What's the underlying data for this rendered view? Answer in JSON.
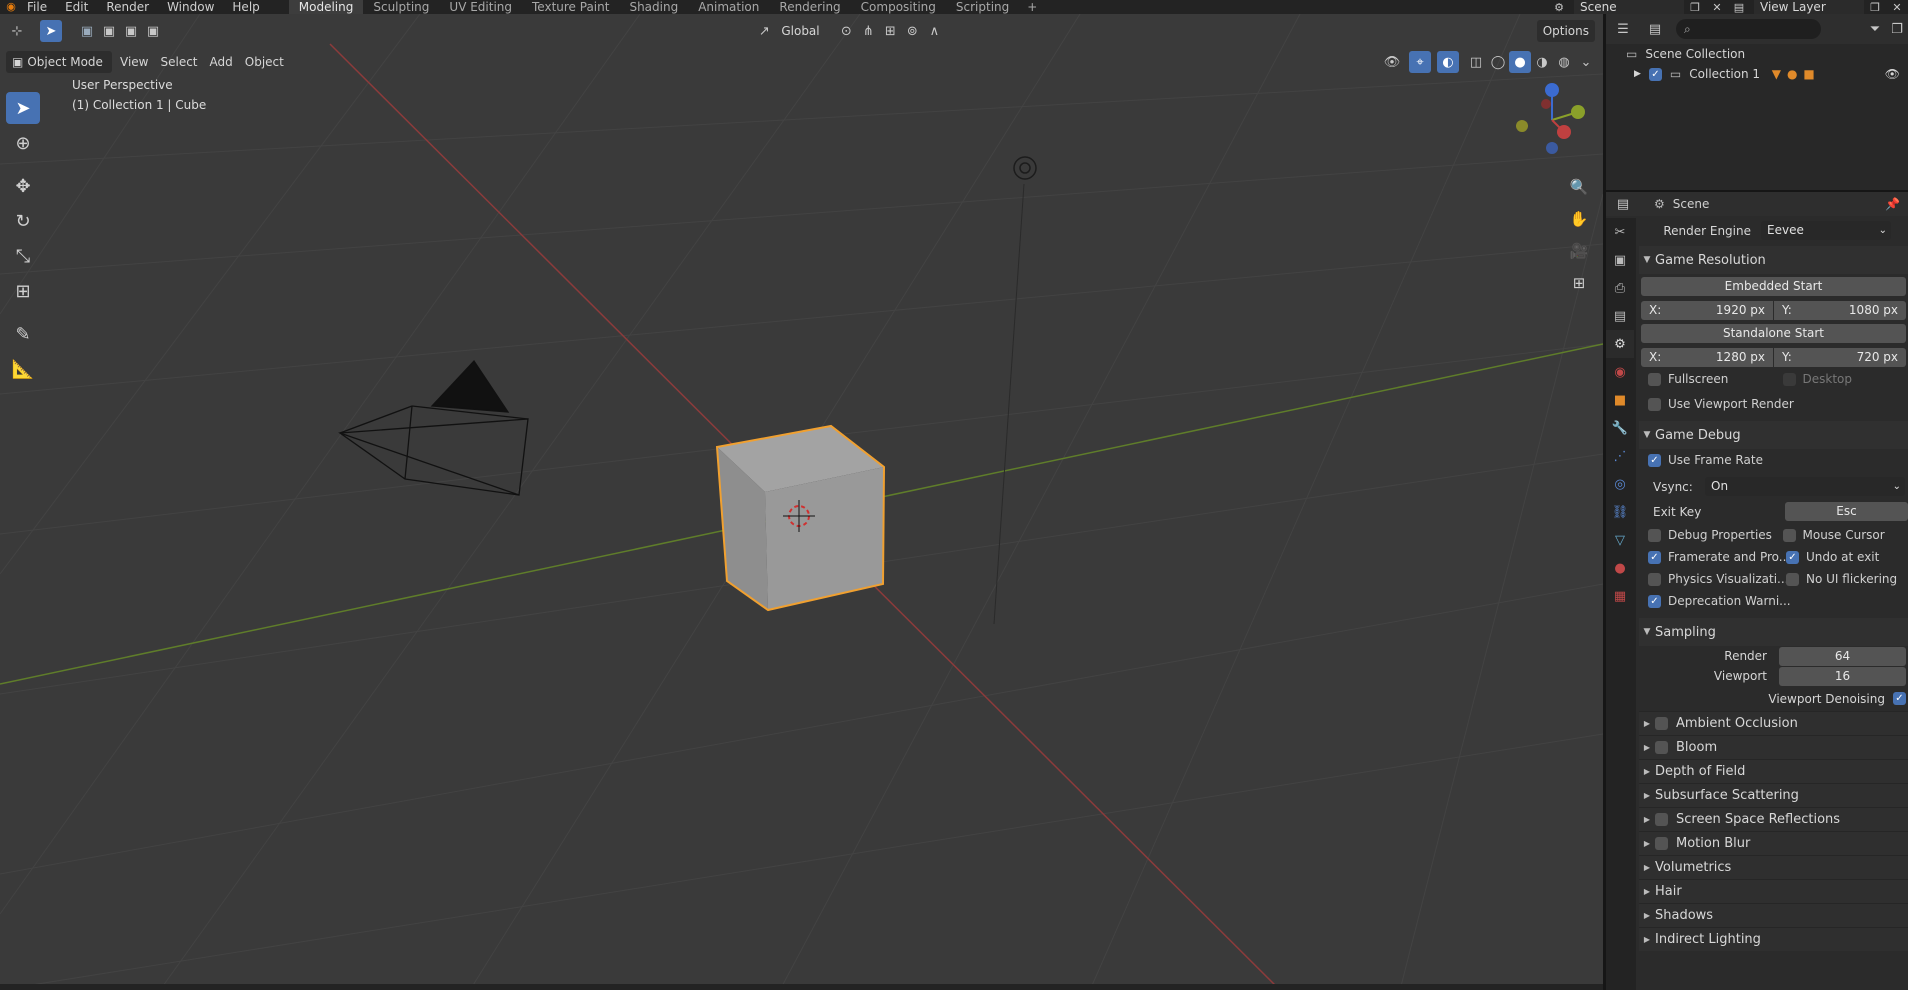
{
  "menu": [
    "File",
    "Edit",
    "Render",
    "Window",
    "Help"
  ],
  "workspaces": [
    "Modeling",
    "Sculpting",
    "UV Editing",
    "Texture Paint",
    "Shading",
    "Animation",
    "Rendering",
    "Compositing",
    "Scripting"
  ],
  "active_workspace": "Modeling",
  "top_right": {
    "scene": "Scene",
    "view_layer": "View Layer"
  },
  "viewport": {
    "transform_orientation": "Global",
    "options_label": "Options",
    "mode": "Object Mode",
    "header_menus": [
      "View",
      "Select",
      "Add",
      "Object"
    ],
    "overlay_line1": "User Perspective",
    "overlay_line2": "(1) Collection 1 | Cube"
  },
  "outliner": {
    "root": "Scene Collection",
    "collection": "Collection 1"
  },
  "properties": {
    "context": "Scene",
    "render_engine_label": "Render Engine",
    "render_engine": "Eevee",
    "game_resolution": {
      "title": "Game Resolution",
      "embedded_label": "Embedded Start",
      "embedded_x": "1920 px",
      "embedded_y": "1080 px",
      "standalone_label": "Standalone Start",
      "standalone_x": "1280 px",
      "standalone_y": "720 px",
      "x_label": "X:",
      "y_label": "Y:",
      "fullscreen": "Fullscreen",
      "desktop": "Desktop",
      "use_viewport_render": "Use Viewport Render"
    },
    "game_debug": {
      "title": "Game Debug",
      "use_frame_rate": "Use Frame Rate",
      "vsync_label": "Vsync:",
      "vsync_value": "On",
      "exit_key_label": "Exit Key",
      "exit_key_value": "Esc",
      "debug_properties": "Debug Properties",
      "mouse_cursor": "Mouse Cursor",
      "framerate": "Framerate and Pro...",
      "undo_at_exit": "Undo at exit",
      "physics_vis": "Physics Visualizati...",
      "no_ui_flickering": "No UI flickering",
      "deprecation": "Deprecation Warni..."
    },
    "sampling": {
      "title": "Sampling",
      "render_label": "Render",
      "render_value": "64",
      "viewport_label": "Viewport",
      "viewport_value": "16",
      "denoise_label": "Viewport Denoising"
    },
    "collapsed_panels": [
      {
        "label": "Ambient Occlusion",
        "checkbox": true
      },
      {
        "label": "Bloom",
        "checkbox": true
      },
      {
        "label": "Depth of Field",
        "checkbox": false
      },
      {
        "label": "Subsurface Scattering",
        "checkbox": false
      },
      {
        "label": "Screen Space Reflections",
        "checkbox": true
      },
      {
        "label": "Motion Blur",
        "checkbox": true
      },
      {
        "label": "Volumetrics",
        "checkbox": false
      },
      {
        "label": "Hair",
        "checkbox": false
      },
      {
        "label": "Shadows",
        "checkbox": false
      },
      {
        "label": "Indirect Lighting",
        "checkbox": false
      }
    ]
  },
  "colors": {
    "accent": "#4772b3",
    "selection_outline": "#f0a030",
    "x_axis": "#9b3a3a",
    "y_axis": "#6a8a2a"
  }
}
